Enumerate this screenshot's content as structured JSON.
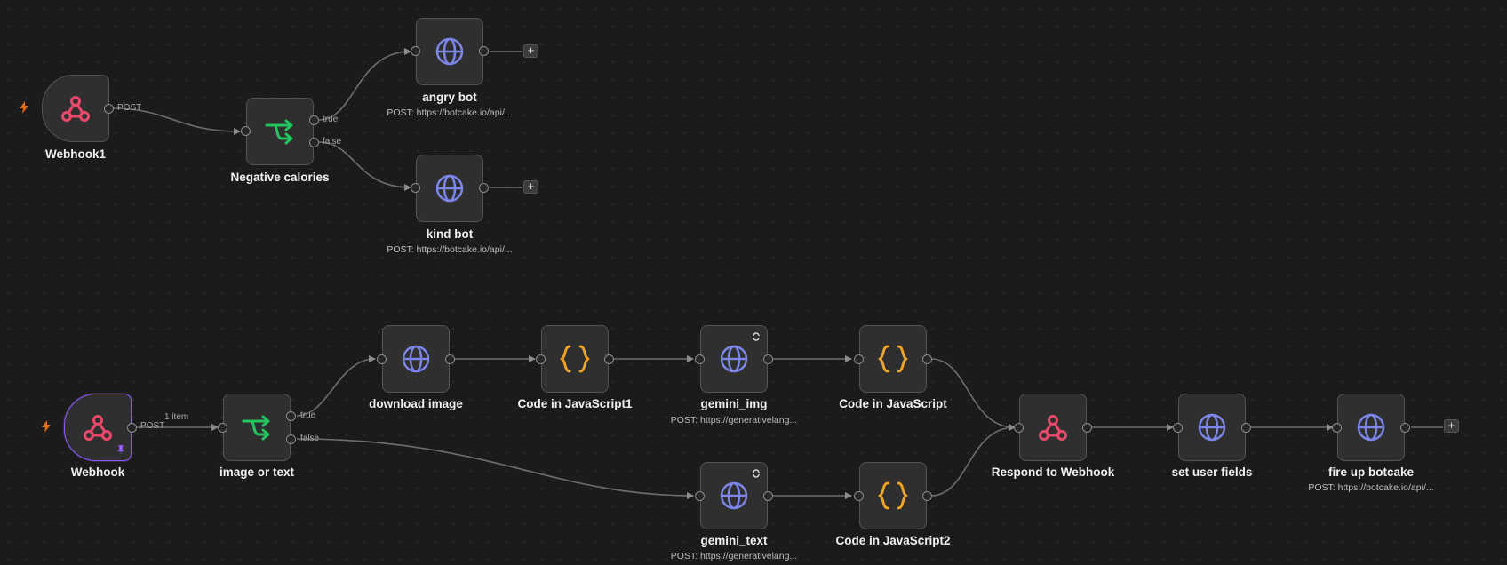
{
  "canvas": {
    "nodes": {
      "webhook1": {
        "name": "Webhook1",
        "icon": "webhook-icon"
      },
      "negative_calories": {
        "name": "Negative calories",
        "icon": "if-icon"
      },
      "angry_bot": {
        "name": "angry bot",
        "subtitle": "POST: https://botcake.io/api/...",
        "icon": "globe-icon"
      },
      "kind_bot": {
        "name": "kind bot",
        "subtitle": "POST: https://botcake.io/api/...",
        "icon": "globe-icon"
      },
      "webhook": {
        "name": "Webhook",
        "icon": "webhook-icon"
      },
      "image_or_text": {
        "name": "image or text",
        "icon": "if-icon"
      },
      "download_image": {
        "name": "download image",
        "icon": "globe-icon"
      },
      "code_js1": {
        "name": "Code in JavaScript1",
        "icon": "code-braces-icon"
      },
      "gemini_img": {
        "name": "gemini_img",
        "subtitle": "POST: https://generativelang...",
        "icon": "globe-icon"
      },
      "code_js": {
        "name": "Code in JavaScript",
        "icon": "code-braces-icon"
      },
      "gemini_text": {
        "name": "gemini_text",
        "subtitle": "POST: https://generativelang...",
        "icon": "globe-icon"
      },
      "code_js2": {
        "name": "Code in JavaScript2",
        "icon": "code-braces-icon"
      },
      "respond_webhook": {
        "name": "Respond to Webhook",
        "icon": "webhook-icon"
      },
      "set_user_fields": {
        "name": "set user fields",
        "icon": "globe-icon"
      },
      "fire_up_botcake": {
        "name": "fire up botcake",
        "subtitle": "POST: https://botcake.io/api/...",
        "icon": "globe-icon"
      }
    },
    "edge_labels": {
      "post1": "POST",
      "post2": "POST",
      "items": "1 item",
      "true1": "true",
      "false1": "false",
      "true2": "true",
      "false2": "false"
    },
    "add_button": "+",
    "colors": {
      "background": "#1b1b1b",
      "node": "#2f2f2f",
      "webhook": "#e8496a",
      "if": "#22c55e",
      "globe": "#7c85e8",
      "code": "#f5a524",
      "trigger": "#ea6a0f",
      "selected": "#8b5cf6"
    }
  }
}
